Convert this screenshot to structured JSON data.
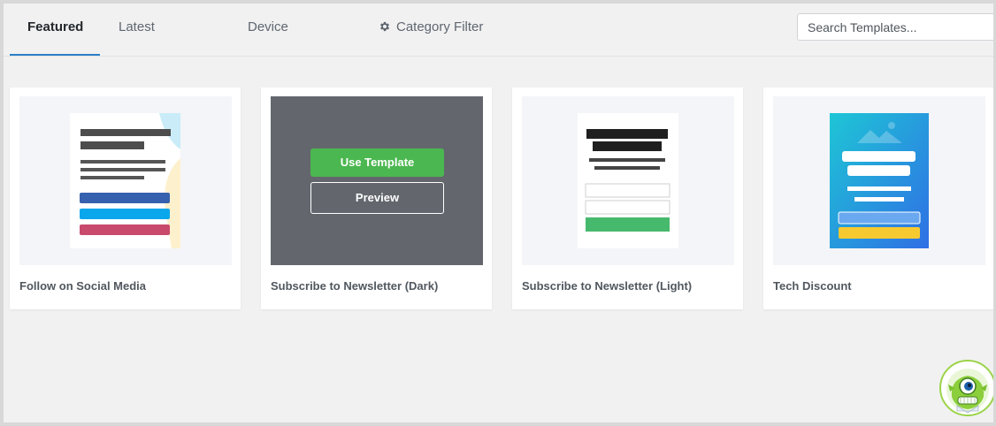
{
  "tabs": [
    {
      "label": "Featured"
    },
    {
      "label": "Latest"
    },
    {
      "label": "Device"
    },
    {
      "label": "Category Filter"
    }
  ],
  "search": {
    "placeholder": "Search Templates..."
  },
  "cards": [
    {
      "title": "Follow on Social Media"
    },
    {
      "title": "Subscribe to Newsletter (Dark)"
    },
    {
      "title": "Subscribe to Newsletter (Light)"
    },
    {
      "title": "Tech Discount"
    }
  ],
  "hover_actions": {
    "use_label": "Use Template",
    "preview_label": "Preview"
  },
  "colors": {
    "accent": "#2b80c8",
    "use_button": "#4bb750",
    "dark_overlay": "#63676d"
  }
}
